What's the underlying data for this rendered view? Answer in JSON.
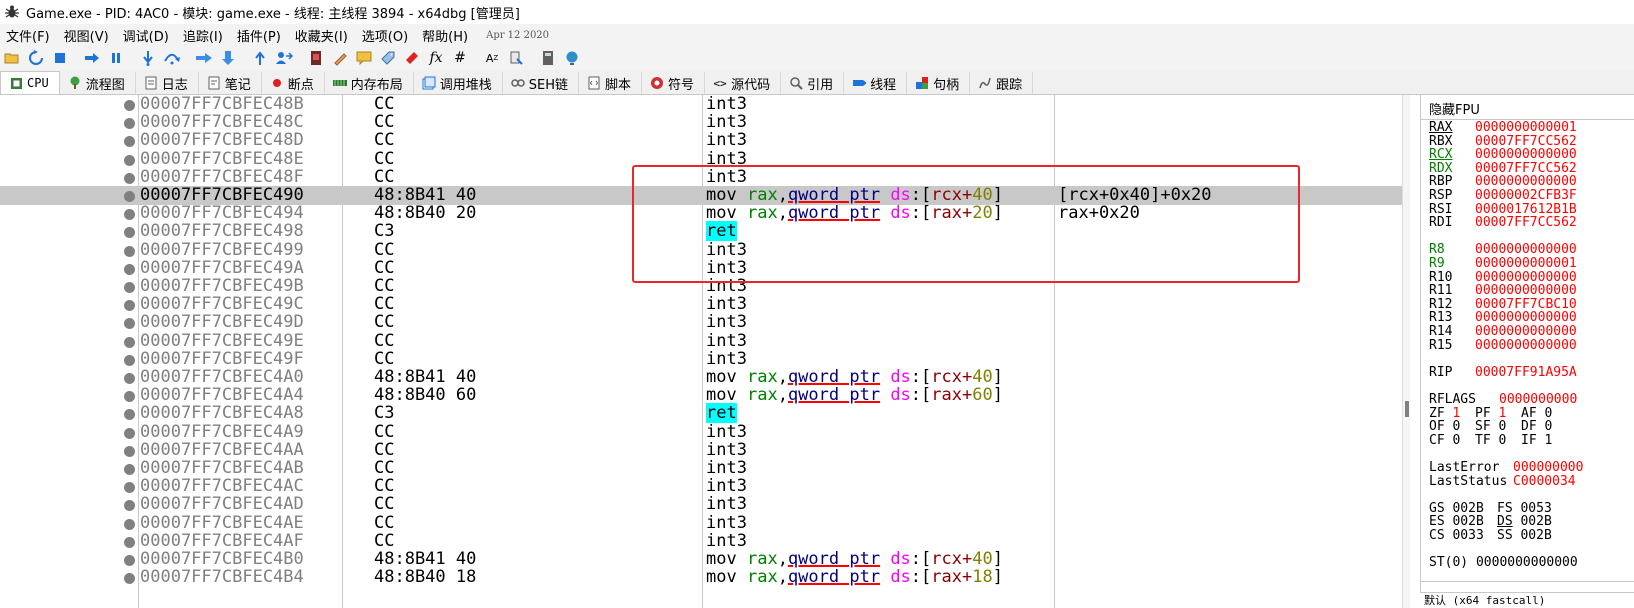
{
  "window": {
    "title": "Game.exe - PID: 4AC0 - 模块: game.exe - 线程: 主线程 3894 - x64dbg [管理员]"
  },
  "menu": {
    "items": [
      "文件(F)",
      "视图(V)",
      "调试(D)",
      "追踪(I)",
      "插件(P)",
      "收藏夹(I)",
      "选项(O)",
      "帮助(H)"
    ],
    "date": "Apr 12 2020"
  },
  "toolbar": {
    "icons": [
      "open-icon",
      "restart-icon",
      "stop-icon",
      "run-icon",
      "pause-icon",
      "step-into-icon",
      "step-over-icon",
      "trace-into-icon",
      "trace-over-icon",
      "execute-till-return-icon",
      "run-to-user-code-icon",
      "script-icon",
      "patch-icon",
      "comment-icon",
      "label-icon",
      "bookmark-icon",
      "function-icon",
      "hash-icon",
      "font-icon",
      "options-icon",
      "calculator-icon",
      "globe-icon"
    ],
    "fx": "fx",
    "hash": "#"
  },
  "tabs": [
    {
      "label": "CPU",
      "icon": "cpu-icon",
      "active": true
    },
    {
      "label": "流程图",
      "icon": "graph-icon"
    },
    {
      "label": "日志",
      "icon": "log-icon"
    },
    {
      "label": "笔记",
      "icon": "notes-icon"
    },
    {
      "label": "断点",
      "icon": "breakpoint-icon"
    },
    {
      "label": "内存布局",
      "icon": "memory-map-icon"
    },
    {
      "label": "调用堆栈",
      "icon": "call-stack-icon"
    },
    {
      "label": "SEH链",
      "icon": "seh-icon"
    },
    {
      "label": "脚本",
      "icon": "script-tab-icon"
    },
    {
      "label": "符号",
      "icon": "symbols-icon"
    },
    {
      "label": "源代码",
      "icon": "source-icon"
    },
    {
      "label": "引用",
      "icon": "references-icon"
    },
    {
      "label": "线程",
      "icon": "threads-icon"
    },
    {
      "label": "句柄",
      "icon": "handles-icon"
    },
    {
      "label": "跟踪",
      "icon": "trace-icon"
    }
  ],
  "disasm": {
    "rows": [
      {
        "addr": "00007FF7CBFEC48B",
        "bytes": "CC",
        "ins": "int3",
        "type": "int3"
      },
      {
        "addr": "00007FF7CBFEC48C",
        "bytes": "CC",
        "ins": "int3",
        "type": "int3"
      },
      {
        "addr": "00007FF7CBFEC48D",
        "bytes": "CC",
        "ins": "int3",
        "type": "int3"
      },
      {
        "addr": "00007FF7CBFEC48E",
        "bytes": "CC",
        "ins": "int3",
        "type": "int3"
      },
      {
        "addr": "00007FF7CBFEC48F",
        "bytes": "CC",
        "ins": "int3",
        "type": "int3"
      },
      {
        "addr": "00007FF7CBFEC490",
        "bytes": "48:8B41 40",
        "type": "mov",
        "dst": "rax",
        "ptr": "qword ptr",
        "seg": "ds",
        "base": "rcx",
        "off": "40",
        "comment": "[rcx+0x40]+0x20",
        "selected": true
      },
      {
        "addr": "00007FF7CBFEC494",
        "bytes": "48:8B40 20",
        "type": "mov",
        "dst": "rax",
        "ptr": "qword ptr",
        "seg": "ds",
        "base": "rax",
        "off": "20",
        "comment": "rax+0x20"
      },
      {
        "addr": "00007FF7CBFEC498",
        "bytes": "C3",
        "ins": "ret",
        "type": "ret"
      },
      {
        "addr": "00007FF7CBFEC499",
        "bytes": "CC",
        "ins": "int3",
        "type": "int3"
      },
      {
        "addr": "00007FF7CBFEC49A",
        "bytes": "CC",
        "ins": "int3",
        "type": "int3"
      },
      {
        "addr": "00007FF7CBFEC49B",
        "bytes": "CC",
        "ins": "int3",
        "type": "int3"
      },
      {
        "addr": "00007FF7CBFEC49C",
        "bytes": "CC",
        "ins": "int3",
        "type": "int3"
      },
      {
        "addr": "00007FF7CBFEC49D",
        "bytes": "CC",
        "ins": "int3",
        "type": "int3"
      },
      {
        "addr": "00007FF7CBFEC49E",
        "bytes": "CC",
        "ins": "int3",
        "type": "int3"
      },
      {
        "addr": "00007FF7CBFEC49F",
        "bytes": "CC",
        "ins": "int3",
        "type": "int3"
      },
      {
        "addr": "00007FF7CBFEC4A0",
        "bytes": "48:8B41 40",
        "type": "mov",
        "dst": "rax",
        "ptr": "qword ptr",
        "seg": "ds",
        "base": "rcx",
        "off": "40"
      },
      {
        "addr": "00007FF7CBFEC4A4",
        "bytes": "48:8B40 60",
        "type": "mov",
        "dst": "rax",
        "ptr": "qword ptr",
        "seg": "ds",
        "base": "rax",
        "off": "60"
      },
      {
        "addr": "00007FF7CBFEC4A8",
        "bytes": "C3",
        "ins": "ret",
        "type": "ret"
      },
      {
        "addr": "00007FF7CBFEC4A9",
        "bytes": "CC",
        "ins": "int3",
        "type": "int3"
      },
      {
        "addr": "00007FF7CBFEC4AA",
        "bytes": "CC",
        "ins": "int3",
        "type": "int3"
      },
      {
        "addr": "00007FF7CBFEC4AB",
        "bytes": "CC",
        "ins": "int3",
        "type": "int3"
      },
      {
        "addr": "00007FF7CBFEC4AC",
        "bytes": "CC",
        "ins": "int3",
        "type": "int3"
      },
      {
        "addr": "00007FF7CBFEC4AD",
        "bytes": "CC",
        "ins": "int3",
        "type": "int3"
      },
      {
        "addr": "00007FF7CBFEC4AE",
        "bytes": "CC",
        "ins": "int3",
        "type": "int3"
      },
      {
        "addr": "00007FF7CBFEC4AF",
        "bytes": "CC",
        "ins": "int3",
        "type": "int3"
      },
      {
        "addr": "00007FF7CBFEC4B0",
        "bytes": "48:8B41 40",
        "type": "mov",
        "dst": "rax",
        "ptr": "qword ptr",
        "seg": "ds",
        "base": "rcx",
        "off": "40"
      },
      {
        "addr": "00007FF7CBFEC4B4",
        "bytes": "48:8B40 18",
        "type": "mov",
        "dst": "rax",
        "ptr": "qword ptr",
        "seg": "ds",
        "base": "rax",
        "off": "18"
      }
    ]
  },
  "registers": {
    "header": "隐藏FPU",
    "general": [
      {
        "name": "RAX",
        "value": "0000000000001",
        "style": "ul"
      },
      {
        "name": "RBX",
        "value": "00007FF7CC562"
      },
      {
        "name": "RCX",
        "value": "0000000000000",
        "style": "green-ul"
      },
      {
        "name": "RDX",
        "value": "00007FF7CC562",
        "style": "green"
      },
      {
        "name": "RBP",
        "value": "0000000000000"
      },
      {
        "name": "RSP",
        "value": "00000002CFB3F"
      },
      {
        "name": "RSI",
        "value": "0000017612B1B"
      },
      {
        "name": "RDI",
        "value": "00007FF7CC562"
      }
    ],
    "extended": [
      {
        "name": "R8",
        "value": "0000000000000",
        "style": "green"
      },
      {
        "name": "R9",
        "value": "0000000000001",
        "style": "green"
      },
      {
        "name": "R10",
        "value": "0000000000000"
      },
      {
        "name": "R11",
        "value": "0000000000000"
      },
      {
        "name": "R12",
        "value": "00007FF7CBC10"
      },
      {
        "name": "R13",
        "value": "0000000000000"
      },
      {
        "name": "R14",
        "value": "0000000000000"
      },
      {
        "name": "R15",
        "value": "0000000000000"
      }
    ],
    "rip": {
      "name": "RIP",
      "value": "00007FF91A95A"
    },
    "rflags": {
      "name": "RFLAGS",
      "value": "0000000000"
    },
    "flags": [
      [
        {
          "n": "ZF",
          "v": "1",
          "hot": true
        },
        {
          "n": "PF",
          "v": "1",
          "hot": true
        },
        {
          "n": "AF",
          "v": "0"
        }
      ],
      [
        {
          "n": "OF",
          "v": "0"
        },
        {
          "n": "SF",
          "v": "0"
        },
        {
          "n": "DF",
          "v": "0"
        }
      ],
      [
        {
          "n": "CF",
          "v": "0"
        },
        {
          "n": "TF",
          "v": "0"
        },
        {
          "n": "IF",
          "v": "1"
        }
      ]
    ],
    "last_error": {
      "name": "LastError",
      "value": "000000000"
    },
    "last_status": {
      "name": "LastStatus",
      "value": "C0000034"
    },
    "segments": [
      [
        {
          "n": "GS",
          "v": "002B"
        },
        {
          "n": "FS",
          "v": "0053"
        }
      ],
      [
        {
          "n": "ES",
          "v": "002B"
        },
        {
          "n": "DS",
          "v": "002B",
          "ul": true
        }
      ],
      [
        {
          "n": "CS",
          "v": "0033"
        },
        {
          "n": "SS",
          "v": "002B"
        }
      ]
    ],
    "st0": {
      "name": "ST(0)",
      "value": "0000000000000"
    }
  },
  "status": {
    "call_convention": "默认 (x64 fastcall)"
  }
}
